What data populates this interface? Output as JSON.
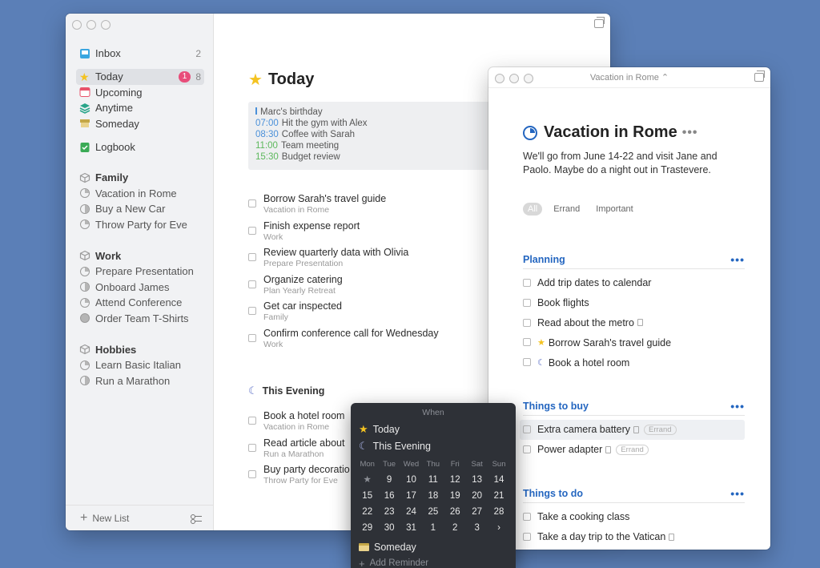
{
  "main": {
    "sidebar": {
      "inbox": {
        "label": "Inbox",
        "count": "2"
      },
      "today": {
        "label": "Today",
        "badge": "1",
        "count": "8"
      },
      "upcoming": {
        "label": "Upcoming"
      },
      "anytime": {
        "label": "Anytime"
      },
      "someday": {
        "label": "Someday"
      },
      "logbook": {
        "label": "Logbook"
      },
      "areas": [
        {
          "label": "Family",
          "projects": [
            "Vacation in Rome",
            "Buy a New Car",
            "Throw Party for Eve"
          ]
        },
        {
          "label": "Work",
          "projects": [
            "Prepare Presentation",
            "Onboard James",
            "Attend Conference",
            "Order Team T-Shirts"
          ]
        },
        {
          "label": "Hobbies",
          "projects": [
            "Learn Basic Italian",
            "Run a Marathon"
          ]
        }
      ],
      "new_list": "New List"
    },
    "title": "Today",
    "calendar_events": [
      {
        "time": "",
        "label": "Marc's birthday",
        "color": "#555555"
      },
      {
        "time": "07:00",
        "label": "Hit the gym with Alex",
        "color": "#4a90d9"
      },
      {
        "time": "08:30",
        "label": "Coffee with Sarah",
        "color": "#4a90d9"
      },
      {
        "time": "11:00",
        "label": "Team meeting",
        "color": "#5cb85c"
      },
      {
        "time": "15:30",
        "label": "Budget review",
        "color": "#5cb85c"
      }
    ],
    "todos": [
      {
        "title": "Borrow Sarah's travel guide",
        "sub": "Vacation in Rome"
      },
      {
        "title": "Finish expense report",
        "sub": "Work"
      },
      {
        "title": "Review quarterly data with Olivia",
        "sub": "Prepare Presentation"
      },
      {
        "title": "Organize catering",
        "sub": "Plan Yearly Retreat"
      },
      {
        "title": "Get car inspected",
        "sub": "Family"
      },
      {
        "title": "Confirm conference call for Wednesday",
        "sub": "Work"
      }
    ],
    "evening_title": "This Evening",
    "evening_todos": [
      {
        "title": "Book a hotel room",
        "sub": "Vacation in Rome"
      },
      {
        "title": "Read article about",
        "sub": "Run a Marathon"
      },
      {
        "title": "Buy party decoratio",
        "sub": "Throw Party for Eve"
      }
    ]
  },
  "project": {
    "window_title": "Vacation in Rome ⌃",
    "title": "Vacation in Rome",
    "more": "•••",
    "notes": "We'll go from June 14-22 and visit Jane and Paolo. Maybe do a night out in Trastevere.",
    "tags": [
      "All",
      "Errand",
      "Important"
    ],
    "sections": [
      {
        "title": "Planning",
        "items": [
          {
            "title": "Add trip dates to calendar"
          },
          {
            "title": "Book flights"
          },
          {
            "title": "Read about the metro",
            "note": true
          },
          {
            "title": "Borrow Sarah's travel guide",
            "star": true
          },
          {
            "title": "Book a hotel room",
            "moon": true
          }
        ]
      },
      {
        "title": "Things to buy",
        "items": [
          {
            "title": "Extra camera battery",
            "note": true,
            "tag": "Errand",
            "selected": true
          },
          {
            "title": "Power adapter",
            "note": true,
            "tag": "Errand"
          }
        ]
      },
      {
        "title": "Things to do",
        "items": [
          {
            "title": "Take a cooking class"
          },
          {
            "title": "Take a day trip to the Vatican",
            "note": true
          }
        ]
      }
    ]
  },
  "when_popover": {
    "title": "When",
    "today": "Today",
    "evening": "This Evening",
    "weekdays": [
      "Mon",
      "Tue",
      "Wed",
      "Thu",
      "Fri",
      "Sat",
      "Sun"
    ],
    "days": [
      "★",
      "9",
      "10",
      "11",
      "12",
      "13",
      "14",
      "15",
      "16",
      "17",
      "18",
      "19",
      "20",
      "21",
      "22",
      "23",
      "24",
      "25",
      "26",
      "27",
      "28",
      "29",
      "30",
      "31",
      "1",
      "2",
      "3",
      "›"
    ],
    "someday": "Someday",
    "add_reminder": "Add Reminder"
  },
  "colors": {
    "accent": "#2466c0",
    "badge": "#e84d7a",
    "star": "#f4c321",
    "background": "#5b7fb7"
  }
}
